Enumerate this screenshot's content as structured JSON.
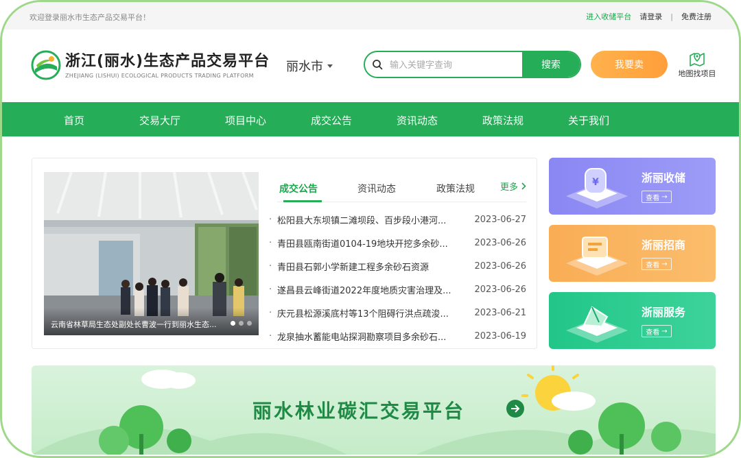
{
  "topbar": {
    "welcome": "欢迎登录丽水市生态产品交易平台！",
    "storage_link": "进入收储平台",
    "login": "请登录",
    "divider": "|",
    "register": "免费注册"
  },
  "header": {
    "brand_cn": "浙江(丽水)生态产品交易平台",
    "brand_en": "ZHEJIANG (LISHUI) ECOLOGICAL PRODUCTS TRADING PLATFORM",
    "city": "丽水市",
    "search_placeholder": "输入关键字查询",
    "search_button": "搜索",
    "sell_button": "我要卖",
    "map_find": "地图找项目"
  },
  "nav": {
    "items": [
      "首页",
      "交易大厅",
      "项目中心",
      "成交公告",
      "资讯动态",
      "政策法规",
      "关于我们"
    ]
  },
  "carousel": {
    "caption": "云南省林草局生态处副处长曹波一行到丽水生态..."
  },
  "news": {
    "tabs": [
      "成交公告",
      "资讯动态",
      "政策法规"
    ],
    "more": "更多",
    "items": [
      {
        "title": "松阳县大东坝镇二滩坝段、百步段小港河...",
        "date": "2023-06-27"
      },
      {
        "title": "青田县瓯南街道0104-19地块开挖多余砂...",
        "date": "2023-06-26"
      },
      {
        "title": "青田县石郭小学新建工程多余砂石资源",
        "date": "2023-06-26"
      },
      {
        "title": "遂昌县云峰街道2022年度地质灾害治理及...",
        "date": "2023-06-26"
      },
      {
        "title": "庆元县松源溪底村等13个阻碍行洪点疏浚...",
        "date": "2023-06-21"
      },
      {
        "title": "龙泉抽水蓄能电站探洞勘察项目多余砂石...",
        "date": "2023-06-19"
      }
    ]
  },
  "side": [
    {
      "label": "浙丽收储",
      "view": "查看",
      "color": "#8f8ef5"
    },
    {
      "label": "浙丽招商",
      "view": "查看",
      "color": "#fbb35b"
    },
    {
      "label": "浙丽服务",
      "view": "查看",
      "color": "#2ccb8e"
    }
  ],
  "banner": {
    "title": "丽水林业碳汇交易平台"
  },
  "colors": {
    "primary_green": "#25ad57",
    "accent_orange": "#ff9f3a"
  }
}
